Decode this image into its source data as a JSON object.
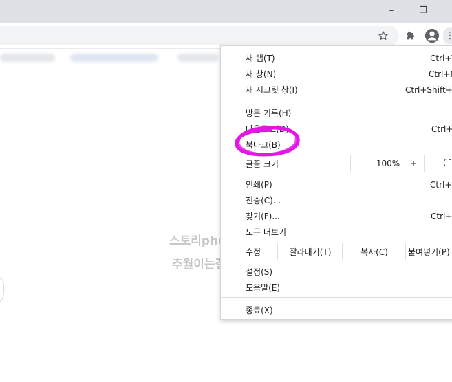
{
  "window": {
    "minimize_label": "–",
    "restore_label": "❐",
    "close_label": "✕"
  },
  "toolbar": {
    "icons": [
      "star-icon",
      "extensions-icon",
      "profile-icon",
      "menu-icon"
    ]
  },
  "watermark": {
    "line1": "스토리photo",
    "line2": "추월이는걸~♡"
  },
  "menu": {
    "new_tab": {
      "label": "새 탭(T)",
      "shortcut": "Ctrl+T"
    },
    "new_window": {
      "label": "새 창(N)",
      "shortcut": "Ctrl+N"
    },
    "incognito": {
      "label": "새 시크릿 창(I)",
      "shortcut": "Ctrl+Shift+N"
    },
    "history": {
      "label": "방문 기록(H)"
    },
    "downloads": {
      "label": "다운로드(D)",
      "shortcut": "Ctrl+J"
    },
    "bookmarks": {
      "label": "북마크(B)"
    },
    "zoom": {
      "label": "글꼴 크기",
      "minus": "–",
      "value": "100%",
      "plus": "+",
      "fullscreen": "⛶"
    },
    "print": {
      "label": "인쇄(P)",
      "shortcut": "Ctrl+P"
    },
    "cast": {
      "label": "전송(C)..."
    },
    "find": {
      "label": "찾기(F)...",
      "shortcut": "Ctrl+F"
    },
    "more_tools": {
      "label": "도구 더보기"
    },
    "edit": {
      "label": "수정",
      "cut": "잘라내기(T)",
      "copy": "복사(C)",
      "paste": "붙여넣기(P)"
    },
    "settings": {
      "label": "설정(S)"
    },
    "help": {
      "label": "도움말(E)"
    },
    "exit": {
      "label": "종료(X)"
    }
  },
  "annotation": {
    "color": "#e516e5"
  }
}
